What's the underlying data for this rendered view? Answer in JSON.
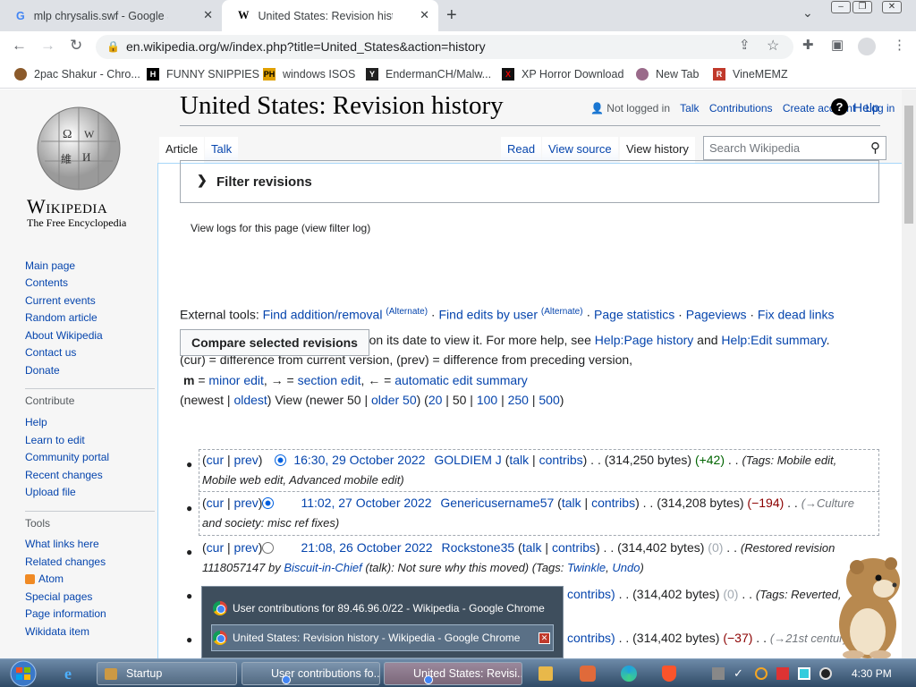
{
  "browser": {
    "tabs": [
      {
        "title": "mlp chrysalis.swf - Google Search",
        "favicon": "google-icon"
      },
      {
        "title": "United States: Revision history - Wikipedia",
        "favicon": "wikipedia-icon",
        "active": true
      }
    ],
    "url": "en.wikipedia.org/w/index.php?title=United_States&action=history",
    "bookmarks": [
      {
        "label": "2pac Shakur - Chro...",
        "color": "#8b5a2b"
      },
      {
        "label": "FUNNY SNIPPIES",
        "color": "#000000"
      },
      {
        "label": "windows ISOS",
        "color": "#e0a000"
      },
      {
        "label": "EndermanCH/Malw...",
        "color": "#202020"
      },
      {
        "label": "XP Horror Download",
        "color": "#b00000"
      },
      {
        "label": "New Tab",
        "color": "#9a6a8a"
      },
      {
        "label": "VineMEMZ",
        "color": "#c0392b"
      }
    ]
  },
  "wiki": {
    "logo_word": "Wikipedia",
    "logo_tagline": "The Free Encyclopedia",
    "personal": {
      "not_logged": "Not logged in",
      "talk": "Talk",
      "contributions": "Contributions",
      "create": "Create account",
      "login": "Log in"
    },
    "tabs": {
      "article": "Article",
      "talk": "Talk",
      "read": "Read",
      "view_source": "View source",
      "view_history": "View history"
    },
    "search_placeholder": "Search Wikipedia",
    "nav": [
      "Main page",
      "Contents",
      "Current events",
      "Random article",
      "About Wikipedia",
      "Contact us",
      "Donate"
    ],
    "contribute_heading": "Contribute",
    "contribute": [
      "Help",
      "Learn to edit",
      "Community portal",
      "Recent changes",
      "Upload file"
    ],
    "tools_heading": "Tools",
    "tools": [
      "What links here",
      "Related changes",
      "Atom",
      "Special pages",
      "Page information",
      "Wikidata item"
    ],
    "title": "United States: Revision history",
    "help": "Help",
    "view_logs": "View logs for this page (view filter log)",
    "filter": "Filter revisions",
    "external_tools_label": "External tools:",
    "ext": {
      "find_add": "Find addition/removal",
      "alt": "(Alternate)",
      "find_user": "Find edits by user",
      "stats": "Page statistics",
      "pageviews": "Pageviews",
      "dead": "Fix dead links"
    },
    "info1a": "For any version listed below, click on its date to view it. For more help, see ",
    "info1_link1": "Help:Page history",
    "info1_and": " and ",
    "info1_link2": "Help:Edit summary",
    "info1_end": ".",
    "info2": "(cur) = difference from current version, (prev) = difference from preceding version,",
    "info3": {
      "m": "m",
      "eq1": " = ",
      "minor": "minor edit",
      ", ": ", ",
      "arrow1": "→ = ",
      "section": "section edit",
      "arrow2": ", ← = ",
      "auto": "automatic edit summary"
    },
    "paging": {
      "newest": "(newest | ",
      "oldest": "oldest",
      ") View (newer 50 | ": ") View (newer 50 | ",
      "older": "older 50",
      ") (": ") (",
      "n20": "20",
      "n50": "50",
      "n100": "100",
      "n250": "250",
      "n500": "500",
      "close": ")"
    },
    "compare_btn": "Compare selected revisions",
    "revisions": [
      {
        "cur": "cur",
        "prev": "prev",
        "date": "16:30, 29 October 2022",
        "user": "GOLDIEM J",
        "size": "(314,250 bytes)",
        "diff": "(+42)",
        "rest": "(Tags: Mobile edit,",
        "rest2": "Mobile web edit, Advanced mobile edit)"
      },
      {
        "cur": "cur",
        "prev": "prev",
        "date": "11:02, 27 October 2022",
        "user": "Genericusername57",
        "size": "(314,208 bytes)",
        "diff": "(−194)",
        "rest": "(→Culture",
        "rest2": "and society: misc ref fixes)"
      },
      {
        "cur": "cur",
        "prev": "prev",
        "date": "21:08, 26 October 2022",
        "user": "Rockstone35",
        "size": "(314,402 bytes)",
        "diff": "(0)",
        "rest": "(Restored revision",
        "rest2a": "1118057147 by ",
        "rest2_user": "Biscuit-in-Chief",
        "rest2b": " (talk): Not sure why this moved) (Tags: ",
        "twinkle": "Twinkle",
        ", ": ", ",
        "undo": "Undo",
        ")": ")"
      },
      {
        "contribs": "contribs)",
        "size": "(314,402 bytes)",
        "diff": "(0)",
        "rest": "(Tags: Reverted,"
      },
      {
        "contribs": "contribs)",
        "size": "(314,402 bytes)",
        "diff": "(−37)",
        "rest": "(→21st century:"
      }
    ],
    "talk": "talk",
    "contribs": "contribs"
  },
  "taskbar_popup": [
    "User contributions for 89.46.96.0/22 - Wikipedia - Google Chrome",
    "United States: Revision history - Wikipedia - Google Chrome"
  ],
  "taskbar": {
    "buttons": [
      "Startup",
      "User contributions fo...",
      "United States: Revisi..."
    ],
    "clock": "4:30 PM"
  }
}
